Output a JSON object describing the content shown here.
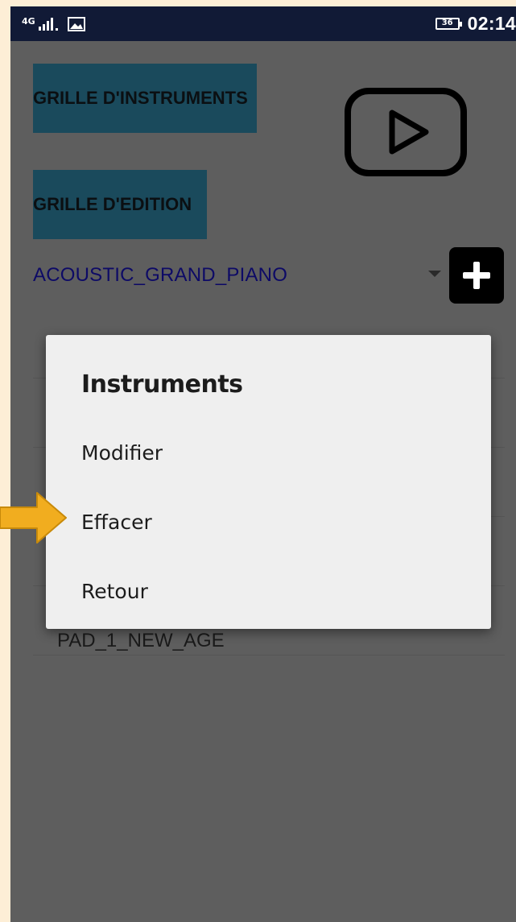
{
  "status_bar": {
    "network_label": "4G",
    "battery_level": "36",
    "time": "02:14"
  },
  "main": {
    "instruments_grid_button": "GRILLE D'INSTRUMENTS",
    "edit_grid_button": "GRILLE D'EDITION",
    "play_icon": "play-icon",
    "selected_instrument": "ACOUSTIC_GRAND_PIANO",
    "add_icon": "plus-icon",
    "list_items": [
      "",
      "",
      "",
      "",
      "PAD_1_NEW_AGE"
    ]
  },
  "dialog": {
    "title": "Instruments",
    "items": [
      "Modifier",
      "Effacer",
      "Retour"
    ]
  },
  "colors": {
    "status_bar": "#111a36",
    "teal_button": "#1a4a5c",
    "annotation_arrow": "#f1ad1f",
    "spinner_text": "#0d0a66"
  }
}
